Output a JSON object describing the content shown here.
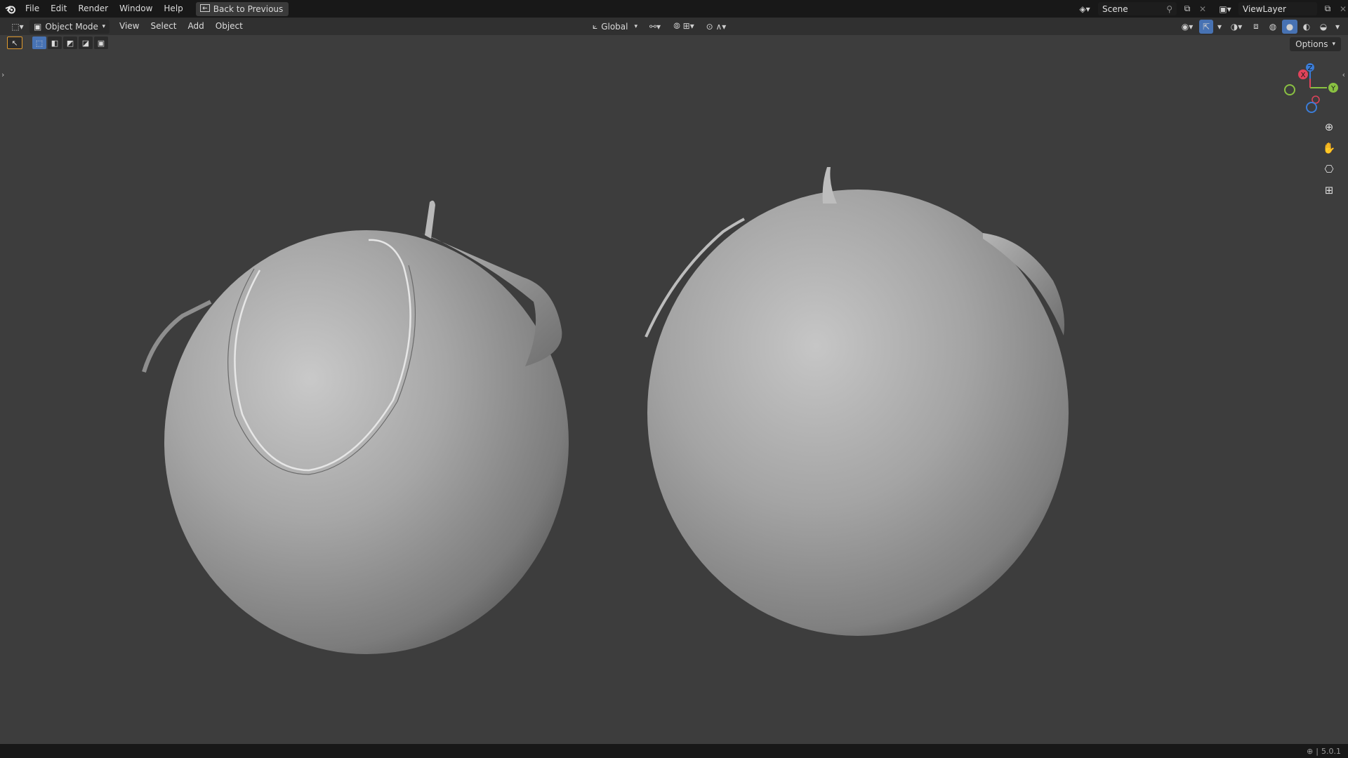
{
  "topbar": {
    "menus": [
      "File",
      "Edit",
      "Render",
      "Window",
      "Help"
    ],
    "back_button": "Back to Previous",
    "scene_label": "Scene",
    "view_layer_label": "ViewLayer"
  },
  "header": {
    "mode": "Object Mode",
    "menus": [
      "View",
      "Select",
      "Add",
      "Object"
    ],
    "transform_orientation": "Global",
    "options_label": "Options"
  },
  "gizmo": {
    "z": "Z",
    "x": "X",
    "y": "Y"
  },
  "status": {
    "version": "5.0.1"
  },
  "colors": {
    "viewport_bg": "#3d3d3d",
    "axis_x": "#e0435b",
    "axis_y": "#8ac142",
    "axis_z": "#3b7dd8",
    "active_blue": "#4772b3"
  },
  "icons": [
    "blender-logo-icon",
    "back-icon",
    "editor-type-icon",
    "object-mode-icon",
    "orientation-icon",
    "pivot-icon",
    "snap-icon",
    "proportional-edit-icon",
    "visibility-icon",
    "gizmo-icon",
    "overlay-icon",
    "xray-icon",
    "wireframe-shading-icon",
    "solid-shading-icon",
    "material-shading-icon",
    "rendered-shading-icon",
    "zoom-icon",
    "pan-hand-icon",
    "camera-view-icon",
    "ortho-grid-icon",
    "pin-icon",
    "new-scene-icon",
    "close-icon",
    "network-icon"
  ]
}
